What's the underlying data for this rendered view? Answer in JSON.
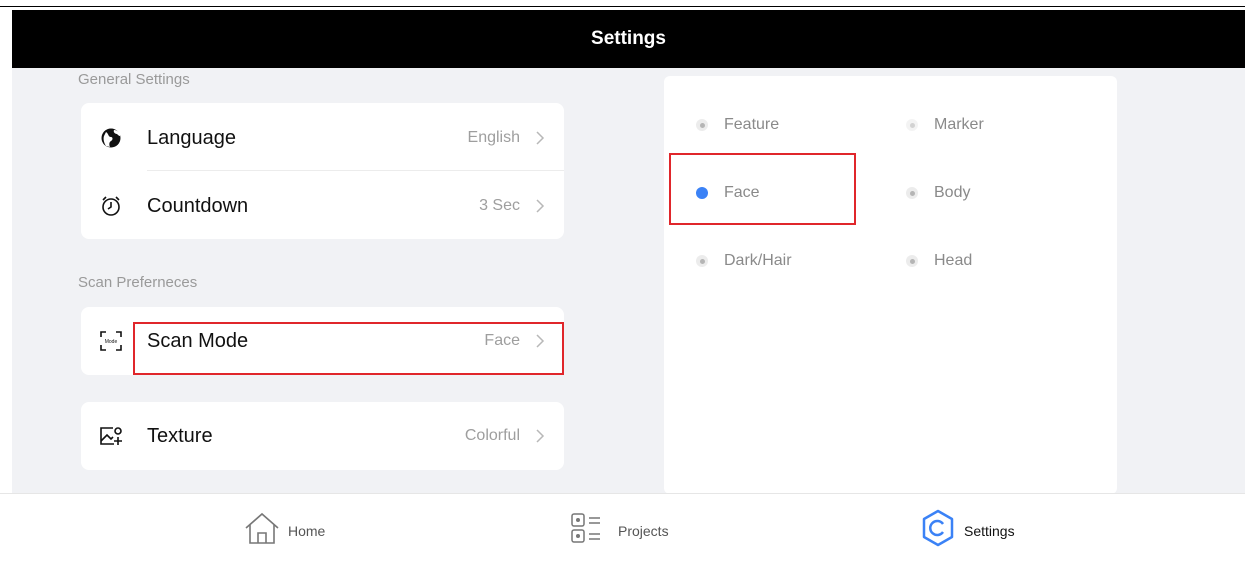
{
  "header": {
    "title": "Settings"
  },
  "general": {
    "section_title": "General Settings",
    "language": {
      "label": "Language",
      "value": "English",
      "icon": "globe-icon"
    },
    "countdown": {
      "label": "Countdown",
      "value": "3 Sec",
      "icon": "timer-icon"
    }
  },
  "scan": {
    "section_title": "Scan Preferneces",
    "mode": {
      "label": "Scan Mode",
      "value": "Face",
      "icon": "scan-mode-icon",
      "icon_text": "Mode"
    },
    "texture": {
      "label": "Texture",
      "value": "Colorful",
      "icon": "texture-icon"
    }
  },
  "scan_mode_options": [
    {
      "label": "Feature",
      "selected": false
    },
    {
      "label": "Marker",
      "selected": false
    },
    {
      "label": "Face",
      "selected": true
    },
    {
      "label": "Body",
      "selected": false
    },
    {
      "label": "Dark/Hair",
      "selected": false
    },
    {
      "label": "Head",
      "selected": false
    }
  ],
  "tabs": [
    {
      "label": "Home",
      "icon": "home-icon",
      "active": false
    },
    {
      "label": "Projects",
      "icon": "projects-icon",
      "active": false
    },
    {
      "label": "Settings",
      "icon": "settings-icon",
      "active": true
    }
  ],
  "colors": {
    "accent": "#3b82f6",
    "highlight": "#e0262b",
    "header_bg": "#000000",
    "content_bg": "#f1f2f5"
  }
}
